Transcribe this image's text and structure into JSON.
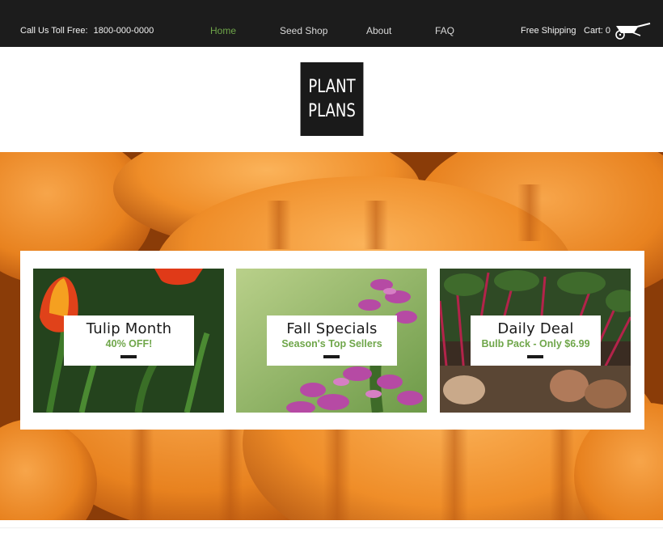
{
  "header": {
    "phone_label": "Call Us Toll Free:",
    "phone_number": "1800-000-0000",
    "nav": [
      "Home",
      "Seed Shop",
      "About",
      "FAQ"
    ],
    "active_nav": "Home",
    "shipping": "Free Shipping",
    "cart": "Cart: 0",
    "cart_icon": "wheelbarrow-icon"
  },
  "logo": {
    "line1": "PLANT",
    "line2": "PLANS"
  },
  "promos": [
    {
      "title": "Tulip Month",
      "subtitle": "40% OFF!"
    },
    {
      "title": "Fall Specials",
      "subtitle": "Season's Top Sellers"
    },
    {
      "title": "Daily Deal",
      "subtitle": "Bulb Pack - Only $6.99"
    }
  ],
  "colors": {
    "topbar": "#1c1c1c",
    "accent": "#6fa64a",
    "pumpkin": "#e8821f"
  }
}
